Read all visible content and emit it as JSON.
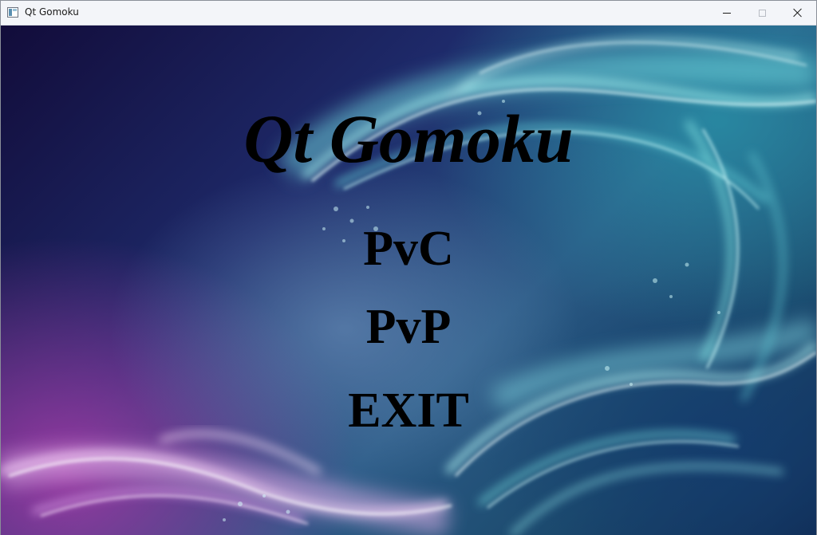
{
  "window": {
    "title": "Qt Gomoku",
    "icon": "app-window-icon",
    "controls": {
      "minimize_icon": "minimize-icon",
      "maximize_icon": "maximize-icon",
      "close_icon": "close-icon"
    }
  },
  "main": {
    "title": "Qt Gomoku",
    "menu": [
      {
        "id": "pvc",
        "label": "PvC"
      },
      {
        "id": "pvp",
        "label": "PvP"
      },
      {
        "id": "exit",
        "label": "EXIT"
      }
    ]
  },
  "colors": {
    "text": "#000000",
    "background_dark": "#120c3a",
    "background_teal": "#2896aa",
    "background_magenta": "#aa3caa"
  }
}
